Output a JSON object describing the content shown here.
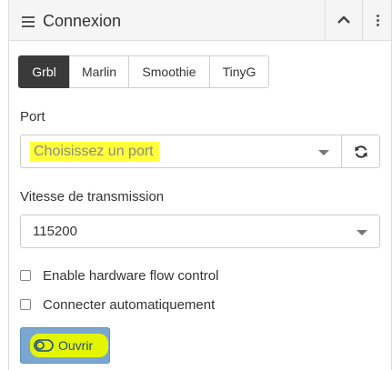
{
  "header": {
    "title": "Connexion",
    "menu_icon": "hamburger-icon",
    "collapse_icon": "chevron-up-icon",
    "more_icon": "kebab-icon"
  },
  "firmware": {
    "options": [
      "Grbl",
      "Marlin",
      "Smoothie",
      "TinyG"
    ],
    "selected": "Grbl"
  },
  "port": {
    "label": "Port",
    "placeholder": "Choisissez un port",
    "refresh_icon": "refresh-icon"
  },
  "baud": {
    "label": "Vitesse de transmission",
    "value": "115200"
  },
  "options": {
    "flow_control": {
      "label": "Enable hardware flow control",
      "checked": false
    },
    "auto_connect": {
      "label": "Connecter automatiquement",
      "checked": false
    }
  },
  "open_button": {
    "label": "Ouvrir",
    "icon": "toggle-off-icon"
  },
  "colors": {
    "highlight": "#ffff3a",
    "button": "#7aa7cf",
    "active_tab": "#3a3a3a"
  }
}
